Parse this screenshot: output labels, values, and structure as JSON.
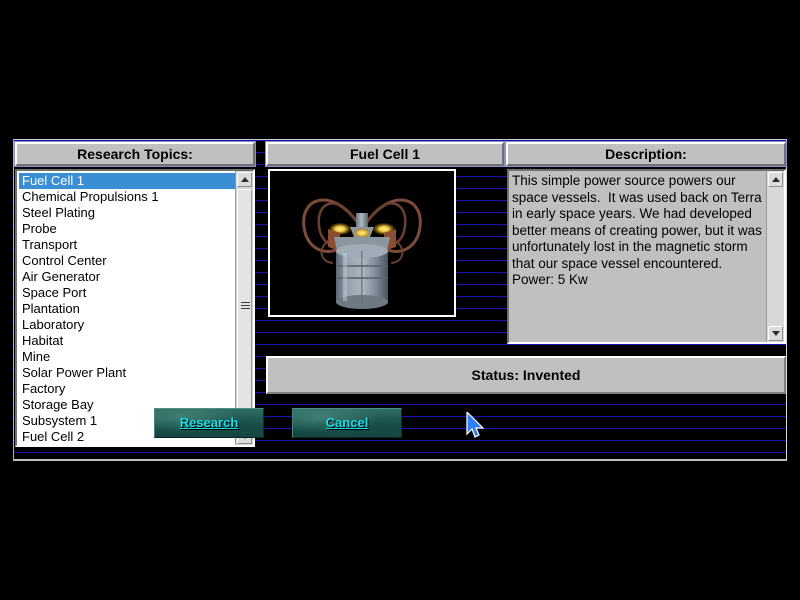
{
  "screen": {
    "background_color": "#000000",
    "scanline_color": "#1a14b4"
  },
  "topics_panel": {
    "header": "Research Topics:",
    "selected_index": 0,
    "items": [
      "Fuel Cell 1",
      "Chemical Propulsions 1",
      "Steel Plating",
      "Probe",
      "Transport",
      "Control Center",
      "Air Generator",
      "Space Port",
      "Plantation",
      "Laboratory",
      "Habitat",
      "Mine",
      "Solar Power Plant",
      "Factory",
      "Storage Bay",
      "Subsystem 1",
      "Fuel Cell 2"
    ],
    "selection_color": "#3a8fd4"
  },
  "image_panel": {
    "header": "Fuel Cell 1",
    "image_alt": "fuel-cell-render"
  },
  "description_panel": {
    "header": "Description:",
    "text": "This simple power source powers our space vessels.  It was used back on Terra in early space years. We had developed better means of creating power, but it was unfortunately lost in the magnetic storm that our space vessel encountered.  Power: 5 Kw"
  },
  "status": {
    "text": "Status: Invented"
  },
  "buttons": {
    "research": "Research",
    "cancel": "Cancel",
    "text_color": "#17e0e8"
  },
  "cursor": {
    "icon": "arrow-pointer"
  }
}
